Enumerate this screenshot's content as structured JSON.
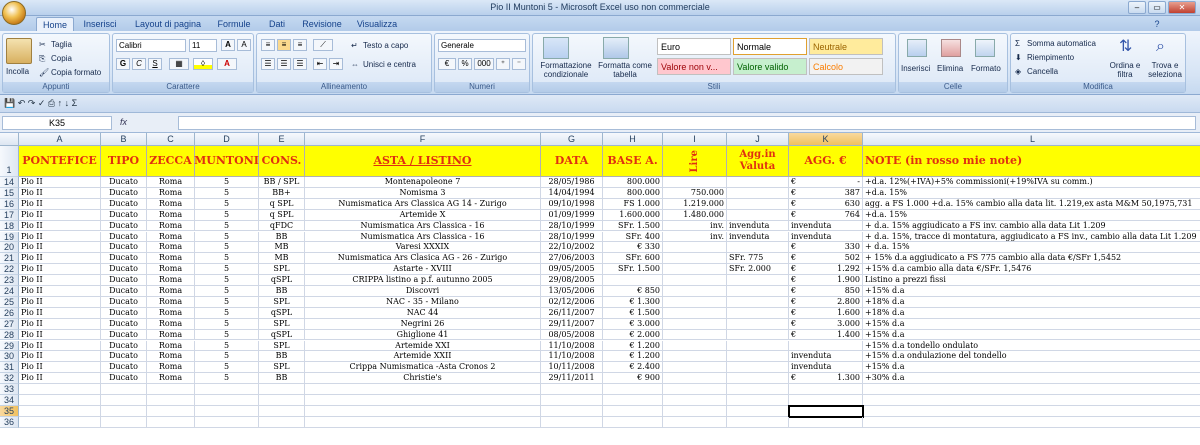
{
  "window": {
    "title": "Pio II Muntoni 5 - Microsoft Excel uso non commerciale",
    "controls": [
      "–",
      "▭",
      "✕"
    ]
  },
  "ribbon_tabs": [
    "Home",
    "Inserisci",
    "Layout di pagina",
    "Formule",
    "Dati",
    "Revisione",
    "Visualizza"
  ],
  "ribbon": {
    "clipboard": {
      "paste": "Incolla",
      "cut": "Taglia",
      "copy": "Copia",
      "format_painter": "Copia formato",
      "label": "Appunti"
    },
    "font": {
      "name": "Calibri",
      "size": "11",
      "grow": "A",
      "shrink": "A",
      "bold": "G",
      "italic": "C",
      "underline": "S",
      "label": "Carattere"
    },
    "alignment": {
      "wrap": "Testo a capo",
      "merge": "Unisci e centra",
      "label": "Allineamento"
    },
    "number": {
      "format": "Generale",
      "currency": "€",
      "percent": "%",
      "thousands": "000",
      "label": "Numeri"
    },
    "styles": {
      "conditional": "Formattazione condizionale",
      "table": "Formatta come tabella",
      "cells": [
        {
          "label": "Euro",
          "bg": "#ffffff",
          "color": "#000000"
        },
        {
          "label": "Normale",
          "bg": "#ffffff",
          "color": "#000000"
        },
        {
          "label": "Neutrale",
          "bg": "#ffeb9c",
          "color": "#9c6500"
        },
        {
          "label": "Valore non v...",
          "bg": "#ffc7ce",
          "color": "#9c0006"
        },
        {
          "label": "Valore valido",
          "bg": "#c6efce",
          "color": "#006100"
        },
        {
          "label": "Calcolo",
          "bg": "#f2f2f2",
          "color": "#fa7d00"
        }
      ],
      "label": "Stili"
    },
    "cells_group": {
      "insert": "Inserisci",
      "delete": "Elimina",
      "format": "Formato",
      "label": "Celle"
    },
    "editing": {
      "autosum": "Somma automatica",
      "fill": "Riempimento",
      "clear": "Cancella",
      "sort": "Ordina e filtra",
      "find": "Trova e seleziona",
      "label": "Modifica"
    }
  },
  "name_box": "K35",
  "fx_label": "fx",
  "columns": [
    "A",
    "B",
    "C",
    "D",
    "E",
    "F",
    "G",
    "H",
    "I",
    "J",
    "K",
    "L"
  ],
  "header_row": {
    "num": "1",
    "cells": [
      "PONTEFICE",
      "TIPO",
      "ZECCA",
      "MUNTONI",
      "CONS.",
      "ASTA / LISTINO",
      "DATA",
      "BASE A.",
      "Lire",
      "Agg.in Valuta",
      "AGG. €",
      "NOTE (in rosso mie note)"
    ]
  },
  "rows": [
    {
      "n": "14",
      "A": "Pio II",
      "B": "Ducato",
      "C": "Roma",
      "D": "5",
      "E": "BB / SPL",
      "F": "Montenapoleone 7",
      "G": "28/05/1986",
      "H": "800.000",
      "I": "",
      "J": "",
      "K1": "€",
      "K2": "-",
      "L": "+d.a. 12%(+IVA)+5% commissioni(+19%IVA su comm.)"
    },
    {
      "n": "15",
      "A": "Pio II",
      "B": "Ducato",
      "C": "Roma",
      "D": "5",
      "E": "BB+",
      "F": "Nomisma 3",
      "G": "14/04/1994",
      "H": "800.000",
      "I": "750.000",
      "J": "",
      "K1": "€",
      "K2": "387",
      "L": "+d.a. 15%"
    },
    {
      "n": "16",
      "A": "Pio II",
      "B": "Ducato",
      "C": "Roma",
      "D": "5",
      "E": "q SPL",
      "F": "Numismatica Ars Classica AG 14 - Zurigo",
      "G": "09/10/1998",
      "H": "FS 1.000",
      "I": "1.219.000",
      "J": "",
      "K1": "€",
      "K2": "630",
      "L": "agg. a FS 1.000 +d.a. 15% cambio alla data lit. 1.219,ex asta M&M 50,1975,731"
    },
    {
      "n": "17",
      "A": "Pio II",
      "B": "Ducato",
      "C": "Roma",
      "D": "5",
      "E": "q SPL",
      "F": "Artemide X",
      "G": "01/09/1999",
      "H": "1.600.000",
      "I": "1.480.000",
      "J": "",
      "K1": "€",
      "K2": "764",
      "L": "+d.a. 15%"
    },
    {
      "n": "18",
      "A": "Pio II",
      "B": "Ducato",
      "C": "Roma",
      "D": "5",
      "E": "qFDC",
      "F": "Numismatica Ars Classica - 16",
      "G": "28/10/1999",
      "H": "SFr.  1.500",
      "I": "inv.",
      "J": "invenduta",
      "K1": "invenduta",
      "K2": "",
      "L": "+ d.a. 15%  aggiudicato  a FS inv. cambio alla data Lit 1.209"
    },
    {
      "n": "19",
      "A": "Pio II",
      "B": "Ducato",
      "C": "Roma",
      "D": "5",
      "E": "BB",
      "F": "Numismatica Ars Classica - 16",
      "G": "28/10/1999",
      "H": "SFr.    400",
      "I": "inv.",
      "J": "invenduta",
      "K1": "invenduta",
      "K2": "",
      "L": "+ d.a. 15%, tracce di montatura, aggiudicato a FS inv., cambio alla data Lit 1.209"
    },
    {
      "n": "20",
      "A": "Pio II",
      "B": "Ducato",
      "C": "Roma",
      "D": "5",
      "E": "MB",
      "F": "Varesi XXXIX",
      "G": "22/10/2002",
      "H": "€      330",
      "I": "",
      "J": "",
      "K1": "€",
      "K2": "330",
      "L": "+ d.a. 15%"
    },
    {
      "n": "21",
      "A": "Pio II",
      "B": "Ducato",
      "C": "Roma",
      "D": "5",
      "E": "MB",
      "F": "Numismatica Ars Clasica AG - 26 - Zurigo",
      "G": "27/06/2003",
      "H": "SFr.    600",
      "I": "",
      "J": "SFr.      775",
      "K1": "€",
      "K2": "502",
      "L": "+ 15% d.a aggiudicato a FS 775 cambio alla data €/SFr 1,5452"
    },
    {
      "n": "22",
      "A": "Pio II",
      "B": "Ducato",
      "C": "Roma",
      "D": "5",
      "E": "SPL",
      "F": "Astarte - XVIII",
      "G": "09/05/2005",
      "H": "SFr.  1.500",
      "I": "",
      "J": "SFr.   2.000",
      "K1": "€",
      "K2": "1.292",
      "L": "+15% d.a cambio alla data €/SFr. 1,5476"
    },
    {
      "n": "23",
      "A": "Pio II",
      "B": "Ducato",
      "C": "Roma",
      "D": "5",
      "E": "qSPL",
      "F": "CRIPPA listino a p.f. autunno 2005",
      "G": "29/08/2005",
      "H": "",
      "I": "",
      "J": "",
      "K1": "€",
      "K2": "1.900",
      "L": "Listino a prezzi fissi"
    },
    {
      "n": "24",
      "A": "Pio II",
      "B": "Ducato",
      "C": "Roma",
      "D": "5",
      "E": "BB",
      "F": "Discovri",
      "G": "13/05/2006",
      "H": "€      850",
      "I": "",
      "J": "",
      "K1": "€",
      "K2": "850",
      "L": "+15% d.a"
    },
    {
      "n": "25",
      "A": "Pio II",
      "B": "Ducato",
      "C": "Roma",
      "D": "5",
      "E": "SPL",
      "F": "NAC - 35 - Milano",
      "G": "02/12/2006",
      "H": "€   1.300",
      "I": "",
      "J": "",
      "K1": "€",
      "K2": "2.800",
      "L": "+18% d.a"
    },
    {
      "n": "26",
      "A": "Pio II",
      "B": "Ducato",
      "C": "Roma",
      "D": "5",
      "E": "qSPL",
      "F": "NAC 44",
      "G": "26/11/2007",
      "H": "€   1.500",
      "I": "",
      "J": "",
      "K1": "€",
      "K2": "1.600",
      "L": "+18% d.a"
    },
    {
      "n": "27",
      "A": "Pio II",
      "B": "Ducato",
      "C": "Roma",
      "D": "5",
      "E": "SPL",
      "F": "Negrini 26",
      "G": "29/11/2007",
      "H": "€   3.000",
      "I": "",
      "J": "",
      "K1": "€",
      "K2": "3.000",
      "L": "+15% d.a"
    },
    {
      "n": "28",
      "A": "Pio II",
      "B": "Ducato",
      "C": "Roma",
      "D": "5",
      "E": "qSPL",
      "F": "Ghiglione 41",
      "G": "08/05/2008",
      "H": "€   2.000",
      "I": "",
      "J": "",
      "K1": "€",
      "K2": "1.400",
      "L": "+15% d.a"
    },
    {
      "n": "29",
      "A": "Pio II",
      "B": "Ducato",
      "C": "Roma",
      "D": "5",
      "E": "SPL",
      "F": "Artemide XXI",
      "G": "11/10/2008",
      "H": "€   1.200",
      "I": "",
      "J": "",
      "K1": "",
      "K2": "",
      "L": "+15% d.a tondello ondulato"
    },
    {
      "n": "30",
      "A": "Pio II",
      "B": "Ducato",
      "C": "Roma",
      "D": "5",
      "E": "BB",
      "F": "Artemide XXII",
      "G": "11/10/2008",
      "H": "€   1.200",
      "I": "",
      "J": "",
      "K1": "invenduta",
      "K2": "",
      "L": "+15% d.a ondulazione del tondello"
    },
    {
      "n": "31",
      "A": "Pio II",
      "B": "Ducato",
      "C": "Roma",
      "D": "5",
      "E": "SPL",
      "F": "Crippa Numismatica -Asta Cronos 2",
      "G": "10/11/2008",
      "H": "€   2.400",
      "I": "",
      "J": "",
      "K1": "invenduta",
      "K2": "",
      "L": "+15% d.a"
    },
    {
      "n": "32",
      "A": "Pio II",
      "B": "Ducato",
      "C": "Roma",
      "D": "5",
      "E": "BB",
      "F": "Christie's",
      "G": "29/11/2011",
      "H": "€      900",
      "I": "",
      "J": "",
      "K1": "€",
      "K2": "1.300",
      "L": "+30% d.a"
    }
  ],
  "empty_rows": [
    "33",
    "34",
    "35",
    "36"
  ]
}
